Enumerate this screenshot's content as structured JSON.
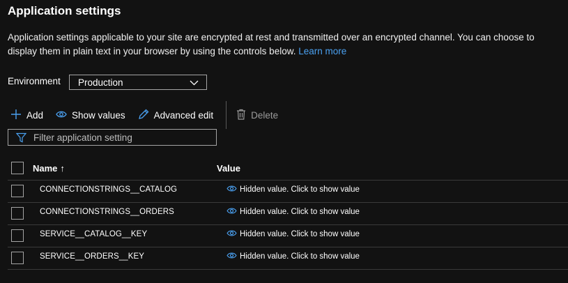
{
  "header": {
    "title": "Application settings",
    "description": "Application settings applicable to your site are encrypted at rest and transmitted over an encrypted channel. You can choose to display them in plain text in your browser by using the controls below.",
    "learn_more": "Learn more"
  },
  "environment": {
    "label": "Environment",
    "selected": "Production"
  },
  "toolbar": {
    "add": "Add",
    "show_values": "Show values",
    "advanced_edit": "Advanced edit",
    "delete": "Delete"
  },
  "filter": {
    "placeholder": "Filter application setting"
  },
  "table": {
    "columns": {
      "name": "Name",
      "sort_indicator": "↑",
      "value": "Value"
    },
    "rows": [
      {
        "name": "CONNECTIONSTRINGS__CATALOG",
        "value": "Hidden value. Click to show value"
      },
      {
        "name": "CONNECTIONSTRINGS__ORDERS",
        "value": "Hidden value. Click to show value"
      },
      {
        "name": "SERVICE__CATALOG__KEY",
        "value": "Hidden value. Click to show value"
      },
      {
        "name": "SERVICE__ORDERS__KEY",
        "value": "Hidden value. Click to show value"
      }
    ]
  },
  "icons": {
    "add": "plus-icon",
    "show_values": "eye-icon",
    "advanced_edit": "pencil-icon",
    "delete": "trash-icon",
    "filter": "funnel-icon",
    "environment": "chevron-down-icon",
    "hidden_value": "eye-icon"
  },
  "colors": {
    "background": "#121212",
    "accent": "#4aa0f0",
    "border": "#a5a5a5",
    "divider": "#3a3a3a"
  }
}
